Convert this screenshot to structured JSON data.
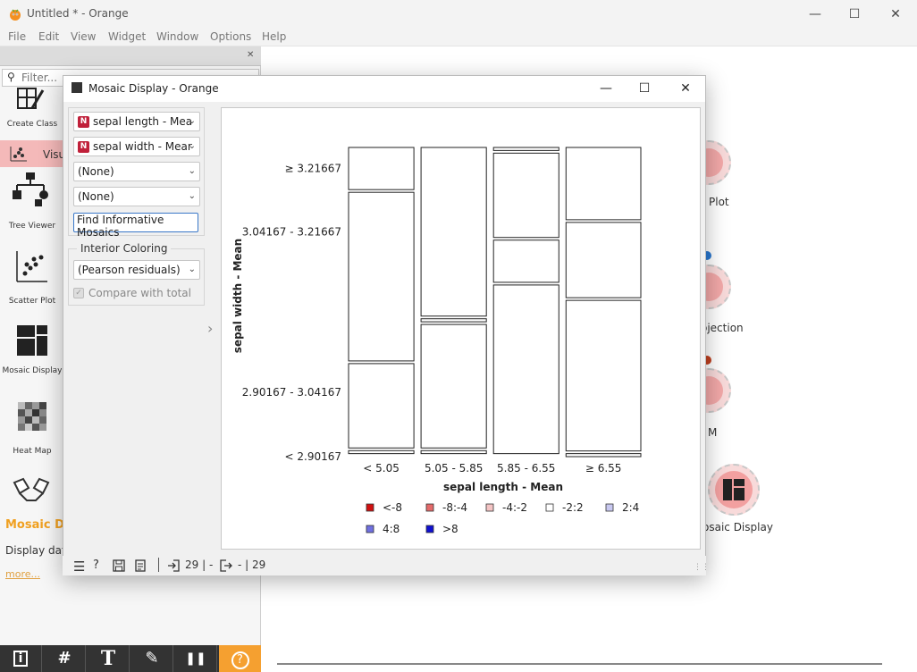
{
  "window": {
    "title": "Untitled * - Orange",
    "controls": {
      "minimize": "—",
      "maximize": "☐",
      "close": "✕"
    }
  },
  "menu": [
    "File",
    "Edit",
    "View",
    "Widget",
    "Window",
    "Options",
    "Help"
  ],
  "toolbox": {
    "filter_placeholder": "Filter...",
    "category": "Visualize",
    "category_visible": "Visu",
    "tools": [
      {
        "label": "Create Class",
        "icon": "create-class-icon"
      },
      {
        "label": "Tree Viewer",
        "icon": "tree-viewer-icon"
      },
      {
        "label": "Scatter Plot",
        "icon": "scatter-plot-icon"
      },
      {
        "label": "Mosaic Display",
        "icon": "mosaic-display-icon"
      },
      {
        "label": "Heat Map",
        "icon": "heat-map-icon"
      }
    ],
    "description": {
      "title": "Mosaic D",
      "text": "Display data",
      "more": "more..."
    },
    "bottom_tools": [
      "info-icon",
      "grid-icon",
      "text-icon",
      "pen-icon",
      "pause-icon",
      "help-icon"
    ],
    "bottom_glyphs": {
      "info": "i",
      "grid": "#",
      "text": "T",
      "pen": "✎",
      "pause": "❚❚",
      "help": "?"
    }
  },
  "canvas_nodes": [
    {
      "label": "Plot"
    },
    {
      "label": "ojection"
    },
    {
      "label": "M"
    },
    {
      "label": "osaic Display"
    }
  ],
  "dialog": {
    "title": "Mosaic Display - Orange",
    "controls": {
      "minimize": "—",
      "maximize": "☐",
      "close": "✕"
    },
    "var1": "sepal length - Mea",
    "var2": "sepal width - Mear",
    "var3": "(None)",
    "var4": "(None)",
    "var_badge": "N",
    "find_button": "Find Informative Mosaics",
    "interior_title": "Interior Coloring",
    "interior_value": "(Pearson residuals)",
    "compare_label": "Compare with total",
    "compare_checked": true,
    "status": {
      "input": "29 | -",
      "output": "- | 29"
    }
  },
  "chart_data": {
    "type": "mosaic",
    "xlabel": "sepal length - Mean",
    "ylabel": "sepal width - Mean",
    "x_categories": [
      "< 5.05",
      "5.05 - 5.85",
      "5.85 - 6.55",
      "≥ 6.55"
    ],
    "y_categories": [
      "≥ 3.21667",
      "3.04167 - 3.21667",
      "2.90167 - 3.04167",
      "< 2.90167"
    ],
    "x_proportions": [
      0.227,
      0.227,
      0.227,
      0.26
    ],
    "y_proportions_per_x": [
      [
        0.14,
        0.56,
        0.28,
        0.01
      ],
      [
        0.56,
        0.01,
        0.41,
        0.01
      ],
      [
        0.01,
        0.28,
        0.14,
        0.56
      ],
      [
        0.24,
        0.25,
        0.5,
        0.01
      ]
    ],
    "residual_class_per_cell": [
      [
        "-2:2",
        "-2:2",
        "-2:2",
        "-2:2"
      ],
      [
        "-2:2",
        "-2:2",
        "-2:2",
        "-2:2"
      ],
      [
        "-2:2",
        "-2:2",
        "-2:2",
        "-2:2"
      ],
      [
        "-2:2",
        "-2:2",
        "-2:2",
        "-2:2"
      ]
    ],
    "legend": [
      {
        "label": "<-8",
        "color": "#d01010"
      },
      {
        "label": "-8:-4",
        "color": "#e46a6a"
      },
      {
        "label": "-4:-2",
        "color": "#f4c4c4"
      },
      {
        "label": "-2:2",
        "color": "#ffffff"
      },
      {
        "label": "2:4",
        "color": "#c8c8f0"
      },
      {
        "label": "4:8",
        "color": "#7070e0"
      },
      {
        "label": ">8",
        "color": "#1010d0"
      }
    ]
  }
}
